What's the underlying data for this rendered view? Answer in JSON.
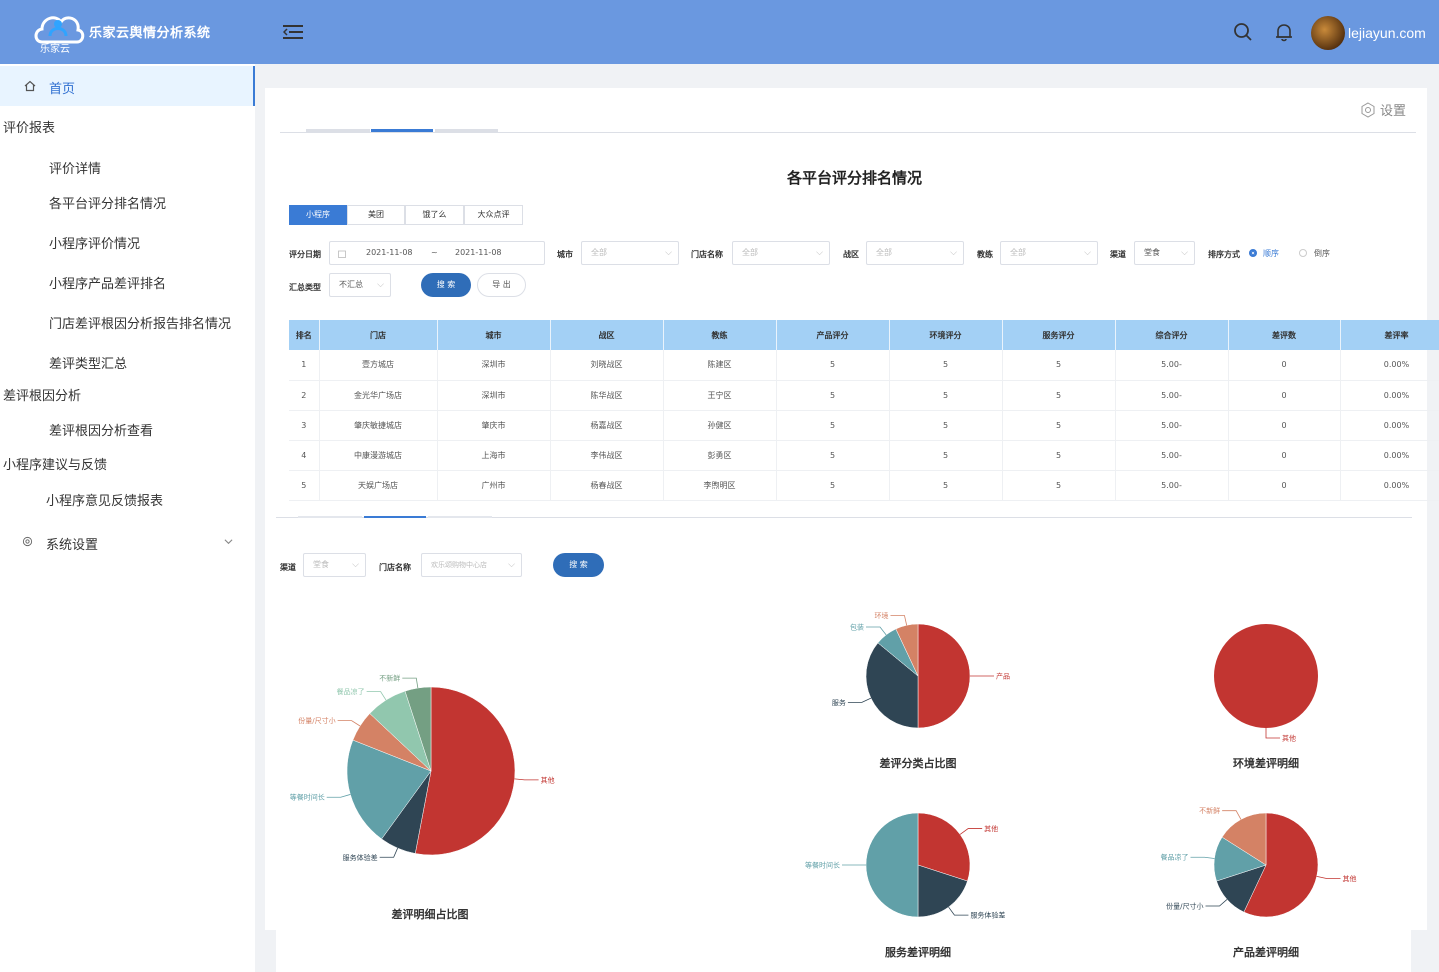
{
  "header": {
    "logo_text": "乐家云",
    "title": "乐家云舆情分析系统",
    "user": "lejiayun.com"
  },
  "sidebar": {
    "home": "首页",
    "groups": [
      {
        "label": "评价报表",
        "items": [
          "评价详情",
          "各平台评分排名情况",
          "小程序评价情况",
          "小程序产品差评排名",
          "门店差评根因分析报告排名情况",
          "差评类型汇总"
        ]
      },
      {
        "label": "差评根因分析",
        "items": [
          "差评根因分析查看"
        ]
      },
      {
        "label": "小程序建议与反馈",
        "items": [
          "小程序意见反馈报表"
        ]
      }
    ],
    "system": "系统设置"
  },
  "settings_label": "设置",
  "page_title": "各平台评分排名情况",
  "platform_tabs": [
    "小程序",
    "美团",
    "饿了么",
    "大众点评"
  ],
  "filters": {
    "date_label": "评分日期",
    "date_start": "2021-11-08",
    "date_sep": "~",
    "date_end": "2021-11-08",
    "city_label": "城市",
    "city_value": "全部",
    "store_label": "门店名称",
    "store_value": "全部",
    "zone_label": "战区",
    "zone_value": "全部",
    "coach_label": "教练",
    "coach_value": "全部",
    "channel_label": "渠道",
    "channel_value": "堂食",
    "sort_label": "排序方式",
    "sort_asc": "顺序",
    "sort_desc": "倒序",
    "summary_label": "汇总类型",
    "summary_value": "不汇总",
    "search": "搜 索",
    "export": "导 出"
  },
  "table": {
    "headers": [
      "排名",
      "门店",
      "城市",
      "战区",
      "教练",
      "产品评分",
      "环境评分",
      "服务评分",
      "综合评分",
      "差评数",
      "差评率"
    ],
    "rows": [
      [
        "1",
        "壹方城店",
        "深圳市",
        "刘晓战区",
        "陈建区",
        "5",
        "5",
        "5",
        "5.00",
        "0",
        "0.00%"
      ],
      [
        "2",
        "金光华广场店",
        "深圳市",
        "陈华战区",
        "王宁区",
        "5",
        "5",
        "5",
        "5.00",
        "0",
        "0.00%"
      ],
      [
        "3",
        "肇庆敏捷城店",
        "肇庆市",
        "杨嘉战区",
        "孙健区",
        "5",
        "5",
        "5",
        "5.00",
        "0",
        "0.00%"
      ],
      [
        "4",
        "中康漫游城店",
        "上海市",
        "李伟战区",
        "彭勇区",
        "5",
        "5",
        "5",
        "5.00",
        "0",
        "0.00%"
      ],
      [
        "5",
        "天娱广场店",
        "广州市",
        "杨春战区",
        "李煦明区",
        "5",
        "5",
        "5",
        "5.00",
        "0",
        "0.00%"
      ]
    ],
    "score_suffix": "-"
  },
  "filters2": {
    "channel_label": "渠道",
    "channel_value": "堂食",
    "store_label": "门店名称",
    "store_value": "欢乐颂购物中心店",
    "search": "搜 索"
  },
  "charts": {
    "detail": {
      "title": "差评明细占比图",
      "slices": [
        {
          "label": "其他",
          "value": 53,
          "color": "#c23531"
        },
        {
          "label": "服务体验差",
          "value": 7,
          "color": "#2f4554"
        },
        {
          "label": "等餐时间长",
          "value": 21,
          "color": "#61a0a8"
        },
        {
          "label": "份量/尺寸小",
          "value": 6,
          "color": "#d48265"
        },
        {
          "label": "餐品凉了",
          "value": 8,
          "color": "#91c7ae"
        },
        {
          "label": "不新鲜",
          "value": 5,
          "color": "#749f83"
        }
      ]
    },
    "category": {
      "title": "差评分类占比图",
      "slices": [
        {
          "label": "产品",
          "value": 50,
          "color": "#c23531"
        },
        {
          "label": "服务",
          "value": 36,
          "color": "#2f4554"
        },
        {
          "label": "包装",
          "value": 7,
          "color": "#61a0a8"
        },
        {
          "label": "环境",
          "value": 7,
          "color": "#d48265"
        }
      ]
    },
    "environment": {
      "title": "环境差评明细",
      "slices": [
        {
          "label": "其他",
          "value": 100,
          "color": "#c23531"
        }
      ]
    },
    "service": {
      "title": "服务差评明细",
      "slices": [
        {
          "label": "其他",
          "value": 30,
          "color": "#c23531"
        },
        {
          "label": "服务体验差",
          "value": 20,
          "color": "#2f4554"
        },
        {
          "label": "等餐时间长",
          "value": 50,
          "color": "#61a0a8"
        }
      ]
    },
    "product": {
      "title": "产品差评明细",
      "slices": [
        {
          "label": "其他",
          "value": 57,
          "color": "#c23531"
        },
        {
          "label": "份量/尺寸小",
          "value": 13,
          "color": "#2f4554"
        },
        {
          "label": "餐品凉了",
          "value": 14,
          "color": "#61a0a8"
        },
        {
          "label": "不新鲜",
          "value": 16,
          "color": "#d48265"
        }
      ]
    }
  }
}
